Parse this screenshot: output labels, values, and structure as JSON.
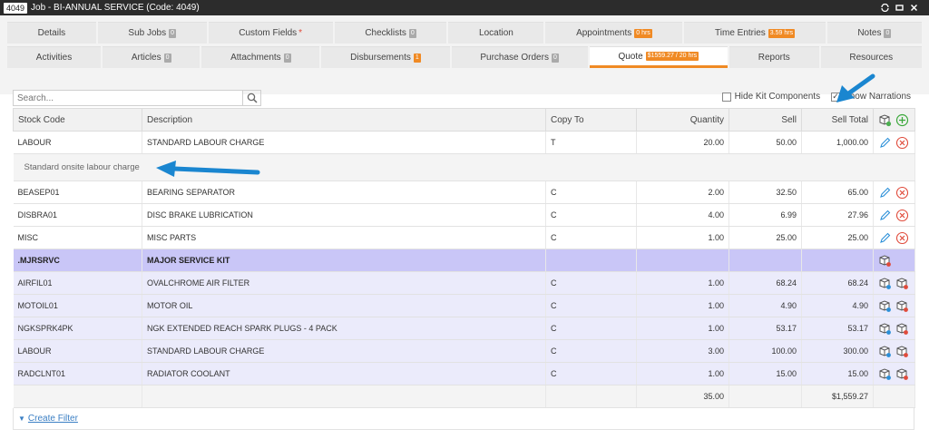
{
  "window": {
    "job_number": "4049",
    "title": "Job - BI-ANNUAL SERVICE (Code: 4049)"
  },
  "tabs_row1": [
    {
      "label": "Details",
      "badge": ""
    },
    {
      "label": "Sub Jobs",
      "badge": "0"
    },
    {
      "label": "Custom Fields",
      "badge": "",
      "required": "*"
    },
    {
      "label": "Checklists",
      "badge": "0"
    },
    {
      "label": "Location",
      "badge": ""
    },
    {
      "label": "Appointments",
      "badge": "0 hrs"
    },
    {
      "label": "Time Entries",
      "badge": "3.59 hrs"
    },
    {
      "label": "Notes",
      "badge": "0"
    }
  ],
  "tabs_row2": [
    {
      "label": "Activities",
      "badge": ""
    },
    {
      "label": "Articles",
      "badge": "0"
    },
    {
      "label": "Attachments",
      "badge": "0"
    },
    {
      "label": "Disbursements",
      "badge": "1"
    },
    {
      "label": "Purchase Orders",
      "badge": "0"
    },
    {
      "label": "Quote",
      "badge": "$1559.27 / 20 hrs"
    },
    {
      "label": "Reports",
      "badge": ""
    },
    {
      "label": "Resources",
      "badge": ""
    }
  ],
  "search": {
    "placeholder": "Search..."
  },
  "options": {
    "hide_kit_label": "Hide Kit Components",
    "show_narrations_label": "Show Narrations",
    "show_narrations_checked": "✓"
  },
  "columns": {
    "stock_code": "Stock Code",
    "description": "Description",
    "copy_to": "Copy To",
    "quantity": "Quantity",
    "sell": "Sell",
    "sell_total": "Sell Total"
  },
  "rows": [
    {
      "code": "LABOUR",
      "desc": "STANDARD LABOUR CHARGE",
      "copy": "T",
      "qty": "20.00",
      "sell": "50.00",
      "total": "1,000.00"
    },
    {
      "code": "BEASEP01",
      "desc": "BEARING SEPARATOR",
      "copy": "C",
      "qty": "2.00",
      "sell": "32.50",
      "total": "65.00"
    },
    {
      "code": "DISBRA01",
      "desc": "DISC BRAKE LUBRICATION",
      "copy": "C",
      "qty": "4.00",
      "sell": "6.99",
      "total": "27.96"
    },
    {
      "code": "MISC",
      "desc": "MISC PARTS",
      "copy": "C",
      "qty": "1.00",
      "sell": "25.00",
      "total": "25.00"
    }
  ],
  "narration": "Standard onsite labour charge",
  "kit": {
    "code": ".MJRSRVC",
    "desc": "MAJOR SERVICE KIT",
    "items": [
      {
        "code": "AIRFIL01",
        "desc": "OVALCHROME AIR FILTER",
        "copy": "C",
        "qty": "1.00",
        "sell": "68.24",
        "total": "68.24"
      },
      {
        "code": "MOTOIL01",
        "desc": "MOTOR OIL",
        "copy": "C",
        "qty": "1.00",
        "sell": "4.90",
        "total": "4.90"
      },
      {
        "code": "NGKSPRK4PK",
        "desc": "NGK EXTENDED REACH SPARK PLUGS - 4 PACK",
        "copy": "C",
        "qty": "1.00",
        "sell": "53.17",
        "total": "53.17"
      },
      {
        "code": "LABOUR",
        "desc": "STANDARD LABOUR CHARGE",
        "copy": "C",
        "qty": "3.00",
        "sell": "100.00",
        "total": "300.00"
      },
      {
        "code": "RADCLNT01",
        "desc": "RADIATOR COOLANT",
        "copy": "C",
        "qty": "1.00",
        "sell": "15.00",
        "total": "15.00"
      }
    ]
  },
  "totals": {
    "qty": "35.00",
    "sell_total": "$1,559.27"
  },
  "filter": {
    "label": "Create Filter"
  },
  "colors": {
    "accent": "#f08a24",
    "kit_header": "#c9c6f7",
    "kit_item": "#ebebfb",
    "link": "#3b7fc4",
    "arrow": "#1a86d0"
  }
}
